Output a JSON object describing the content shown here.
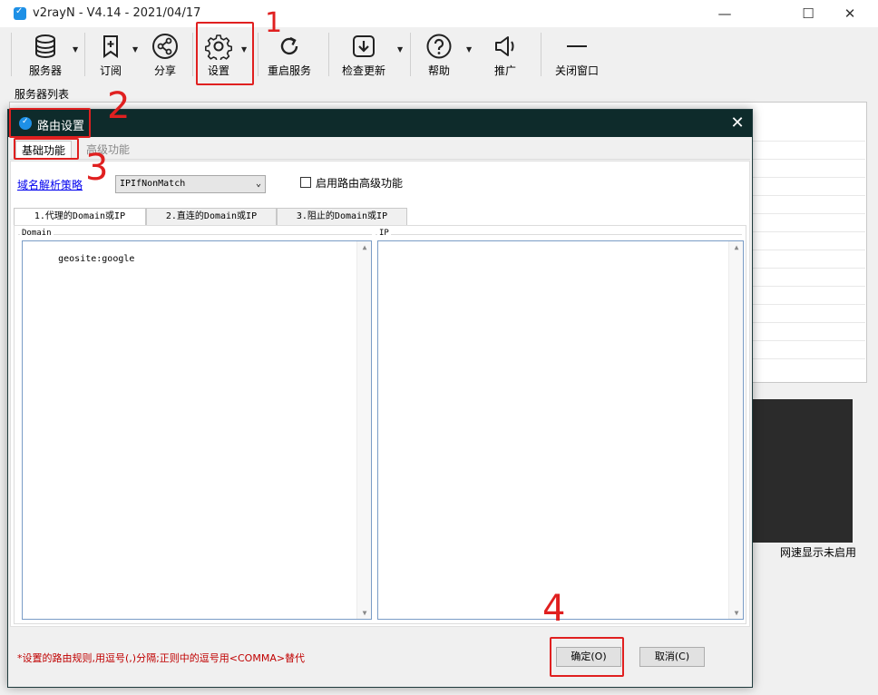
{
  "window": {
    "title": "v2rayN - V4.14 - 2021/04/17",
    "minimize": "—",
    "maximize": "☐",
    "close": "✕"
  },
  "toolbar": {
    "servers": "服务器",
    "subscribe": "订阅",
    "share": "分享",
    "settings": "设置",
    "restart": "重启服务",
    "update": "检查更新",
    "help": "帮助",
    "promote": "推广",
    "close_window": "关闭窗口"
  },
  "main": {
    "server_list_label": "服务器列表",
    "speed_status": "网速显示未启用"
  },
  "dialog": {
    "title": "路由设置",
    "close": "✕",
    "tabs": [
      "基础功能",
      "高级功能"
    ],
    "domain_strategy_label": "域名解析策略",
    "domain_strategy_value": "IPIfNonMatch",
    "enable_advanced_label": "启用路由高级功能",
    "sub_tabs": [
      "1.代理的Domain或IP",
      "2.直连的Domain或IP",
      "3.阻止的Domain或IP"
    ],
    "domain_group": "Domain",
    "ip_group": "IP",
    "domain_value": "geosite:google",
    "ip_value": "",
    "footer_note": "*设置的路由规则,用逗号(,)分隔;正则中的逗号用<COMMA>替代",
    "ok_button": "确定(O)",
    "cancel_button": "取消(C)"
  },
  "annotations": {
    "step1": "1",
    "step2": "2",
    "step3": "3",
    "step4": "4",
    "color": "#e02020"
  }
}
